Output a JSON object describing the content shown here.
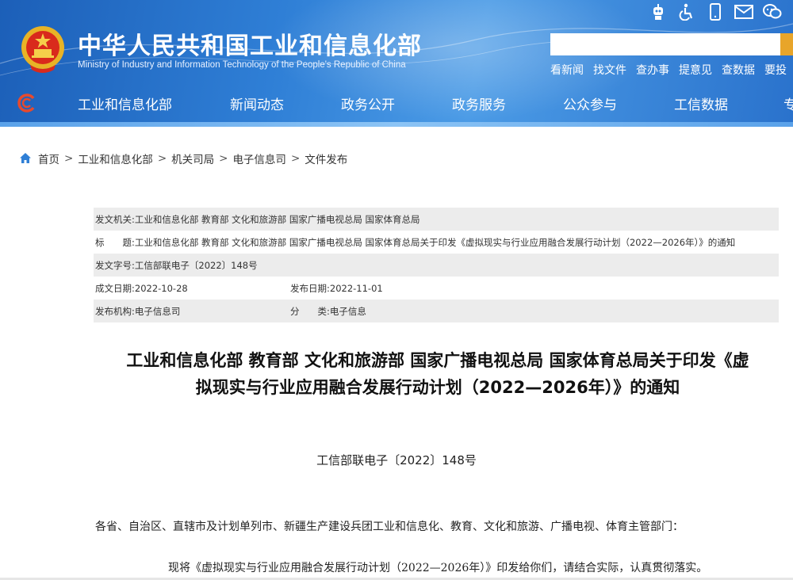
{
  "header": {
    "title_cn": "中华人民共和国工业和信息化部",
    "title_en": "Ministry of Industry and Information Technology of the People's Republic of China",
    "search": {
      "placeholder": ""
    },
    "quick_links": [
      "看新闻",
      "找文件",
      "查办事",
      "提意见",
      "查数据",
      "要投"
    ],
    "top_icons": [
      "robot-icon",
      "accessibility-icon",
      "mobile-icon",
      "mail-icon",
      "wechat-icon"
    ],
    "nav": [
      "工业和信息化部",
      "新闻动态",
      "政务公开",
      "政务服务",
      "公众参与",
      "工信数据",
      "专"
    ],
    "colors": {
      "header_bg": "#2f7fd6",
      "search_btn": "#e8a52a"
    }
  },
  "breadcrumb": [
    "首页",
    "工业和信息化部",
    "机关司局",
    "电子信息司",
    "文件发布"
  ],
  "meta": {
    "issuer_label": "发文机关:",
    "issuer": "工业和信息化部 教育部 文化和旅游部 国家广播电视总局 国家体育总局",
    "title_label": "标　　题:",
    "title": "工业和信息化部 教育部 文化和旅游部 国家广播电视总局 国家体育总局关于印发《虚拟现实与行业应用融合发展行动计划（2022—2026年）》的通知",
    "docno_label": "发文字号:",
    "docno": "工信部联电子〔2022〕148号",
    "created_label": "成文日期:",
    "created": "2022-10-28",
    "published_label": "发布日期:",
    "published": "2022-11-01",
    "org_label": "发布机构:",
    "org": "电子信息司",
    "category_label": "分　　类:",
    "category": "电子信息"
  },
  "article": {
    "title_line1": "工业和信息化部 教育部 文化和旅游部 国家广播电视总局 国家体育总局关于印发《虚",
    "title_line2": "拟现实与行业应用融合发展行动计划（2022—2026年）》的通知",
    "doc_number": "工信部联电子〔2022〕148号",
    "paragraph1": "各省、自治区、直辖市及计划单列市、新疆生产建设兵团工业和信息化、教育、文化和旅游、广播电视、体育主管部门：",
    "paragraph2": "现将《虚拟现实与行业应用融合发展行动计划（2022—2026年）》印发给你们，请结合实际，认真贯彻落实。"
  }
}
